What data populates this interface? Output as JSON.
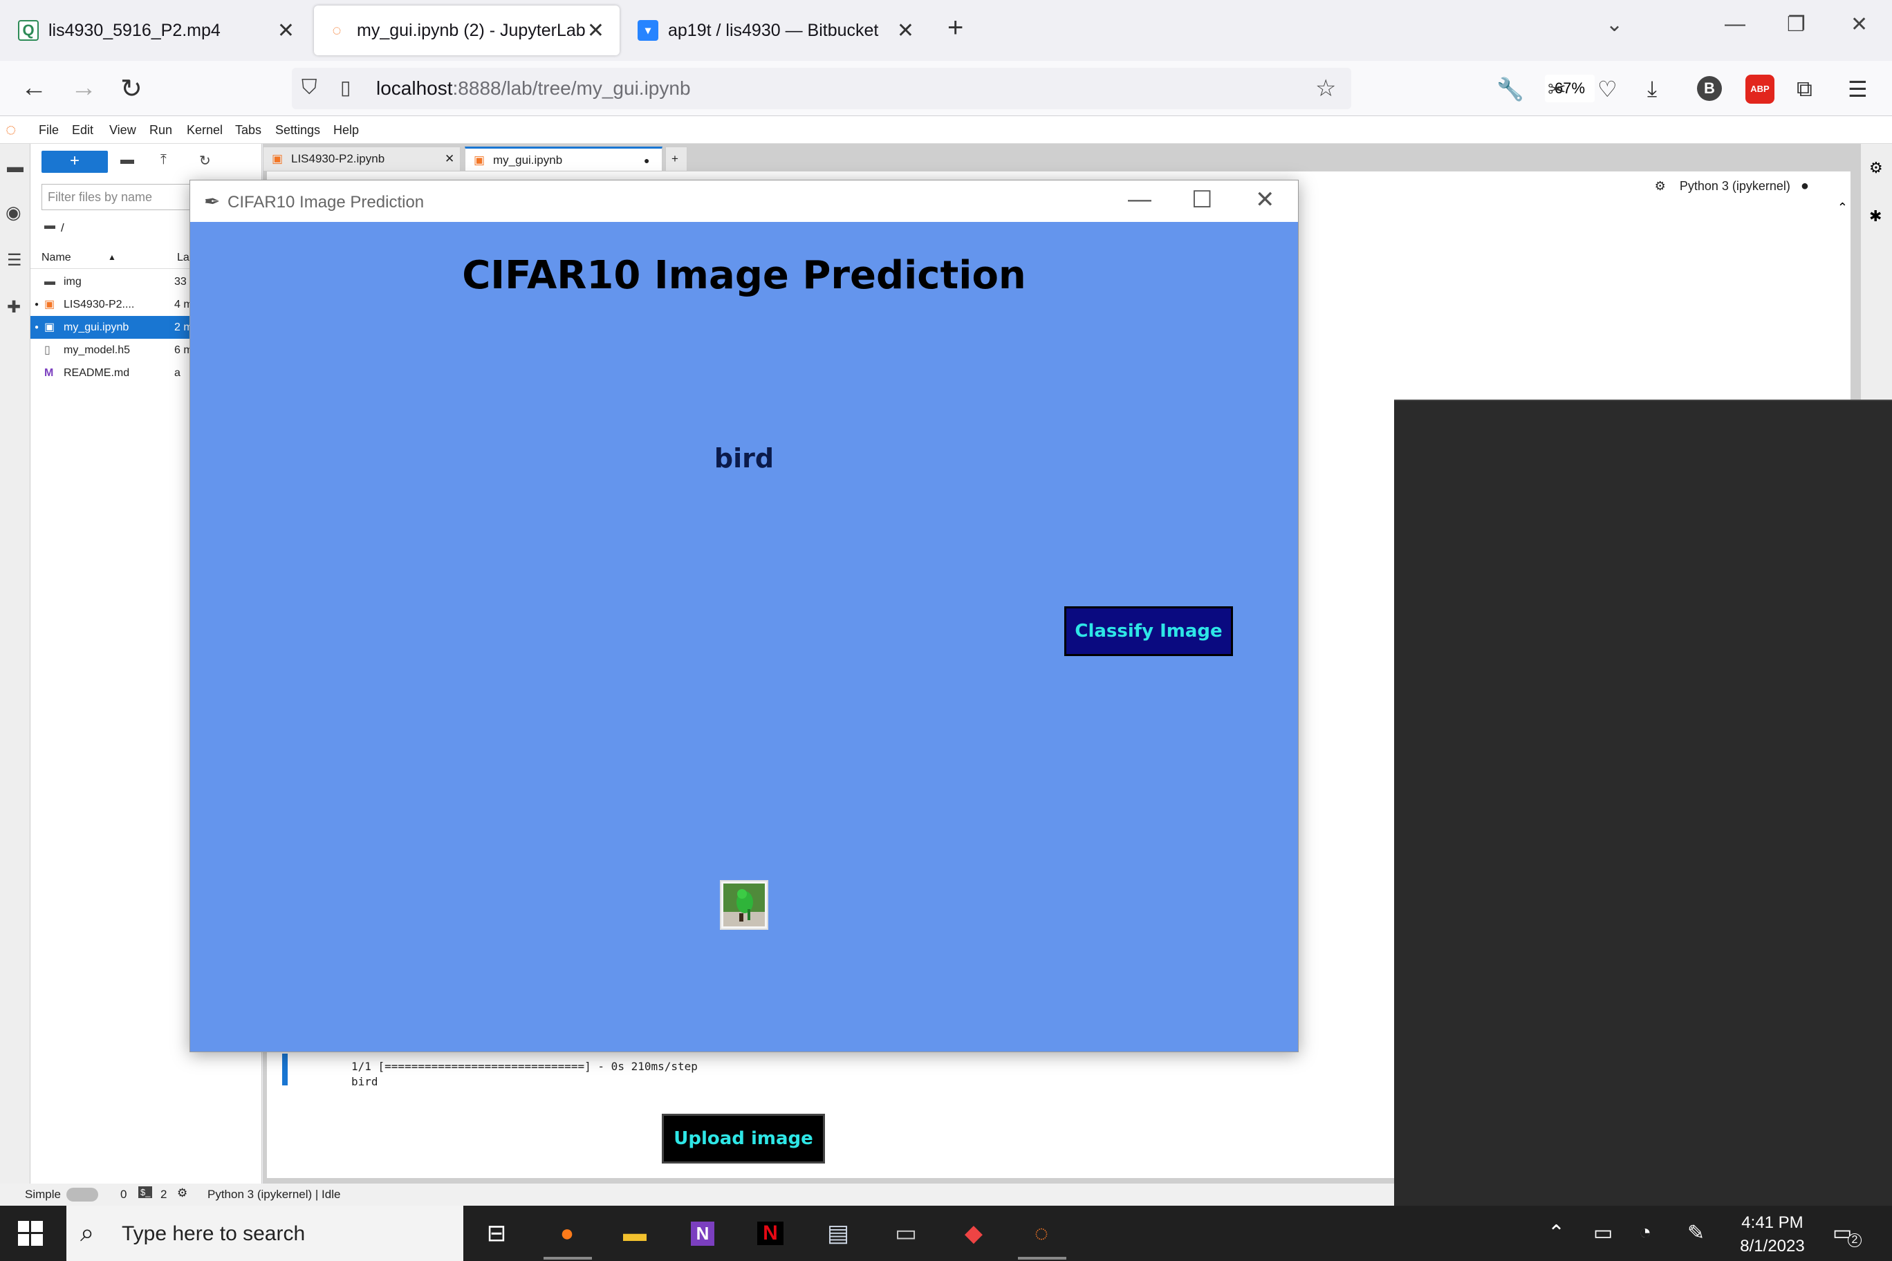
{
  "browser": {
    "tabs": [
      {
        "title": "lis4930_5916_P2.mp4",
        "favicon": "Q"
      },
      {
        "title": "my_gui.ipynb (2) - JupyterLab",
        "favicon": "jupyter"
      },
      {
        "title": "ap19t / lis4930 — Bitbucket",
        "favicon": "bitbucket"
      }
    ],
    "url_host": "localhost",
    "url_path": ":8888/lab/tree/my_gui.ipynb",
    "zoom": "67%",
    "profile_initial": "B",
    "adblock_label": "ABP"
  },
  "jupyter": {
    "menu": [
      "File",
      "Edit",
      "View",
      "Run",
      "Kernel",
      "Tabs",
      "Settings",
      "Help"
    ],
    "filter_placeholder": "Filter files by name",
    "breadcrumb": "/",
    "columns": {
      "name": "Name",
      "modified": "La"
    },
    "files": [
      {
        "name": "img",
        "modified": "33 m"
      },
      {
        "name": "LIS4930-P2....",
        "modified": "4 m"
      },
      {
        "name": "my_gui.ipynb",
        "modified": "2 m"
      },
      {
        "name": "my_model.h5",
        "modified": "6 m"
      },
      {
        "name": "README.md",
        "modified": "a"
      }
    ],
    "doc_tabs": [
      "LIS4930-P2.ipynb",
      "my_gui.ipynb"
    ],
    "kernel": "Python 3 (ipykernel)",
    "output_lines": [
      "1/1 [==============================] - 0s 210ms/step",
      "bird"
    ],
    "status": {
      "mode": "Simple",
      "count_a": "0",
      "count_b": "2",
      "kernel_state": "Python 3 (ipykernel) | Idle"
    }
  },
  "dialog": {
    "window_title": "CIFAR10 Image Prediction",
    "heading": "CIFAR10 Image Prediction",
    "prediction": "bird",
    "classify_label": "Classify Image",
    "upload_label": "Upload image",
    "background": "#6495ed"
  },
  "taskbar": {
    "search_placeholder": "Type here to search",
    "time": "4:41 PM",
    "date": "8/1/2023",
    "notifications": "2"
  }
}
